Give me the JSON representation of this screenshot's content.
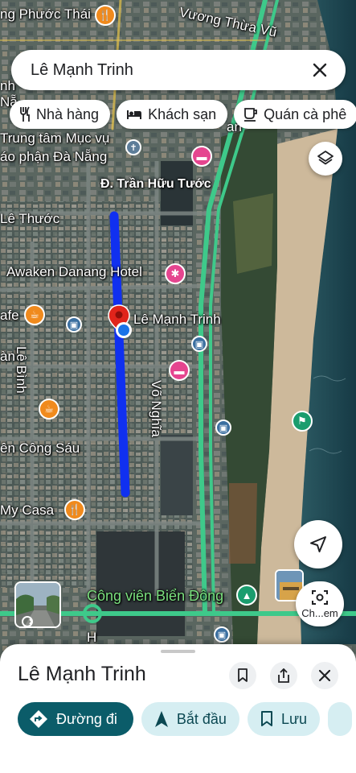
{
  "search": {
    "query": "Lê Mạnh Trinh"
  },
  "chips": [
    {
      "label": "Nhà hàng",
      "icon": "restaurant-icon"
    },
    {
      "label": "Khách sạn",
      "icon": "hotel-icon"
    },
    {
      "label": "Quán cà phê",
      "icon": "coffee-icon"
    }
  ],
  "map": {
    "labels": {
      "phuoc_thai": "ng Phước Thái",
      "vuong_thua_vu": "Vương Thừa Vũ",
      "trung_tam": "Trung tâm Mục vụ",
      "giao_phan": "áo phận Đà Nẵng",
      "tran_huu_tuoc": "Đ. Trần Hữu Tước",
      "le_thuoc": "Lê Thước",
      "awaken": "Awaken Danang Hotel",
      "afe": "afe",
      "le_manh_trinh": "Lê Mạnh Trinh",
      "le_binh": "Lê Bình",
      "an": "àn",
      "vo_nghia": "Võ Nghĩa",
      "cong_sau": "ên Công Sáu",
      "my_casa": "My Casa",
      "cong_vien": "Công viên Biển Đông",
      "nang": "Nẵ",
      "nh": "nh",
      "an2": "an",
      "h": "H"
    }
  },
  "buttons": {
    "lens_label": "Ch...em"
  },
  "sheet": {
    "title": "Lê Mạnh Trinh",
    "actions": [
      {
        "label": "Đường đi",
        "icon": "directions-icon"
      },
      {
        "label": "Bắt đầu",
        "icon": "navigation-arrow-icon"
      },
      {
        "label": "Lưu",
        "icon": "bookmark-icon"
      }
    ]
  },
  "colors": {
    "route": "#1030f0",
    "primary_button": "#0b5c69",
    "secondary_button": "#d6eef2",
    "main_road": "#3ec98a"
  }
}
